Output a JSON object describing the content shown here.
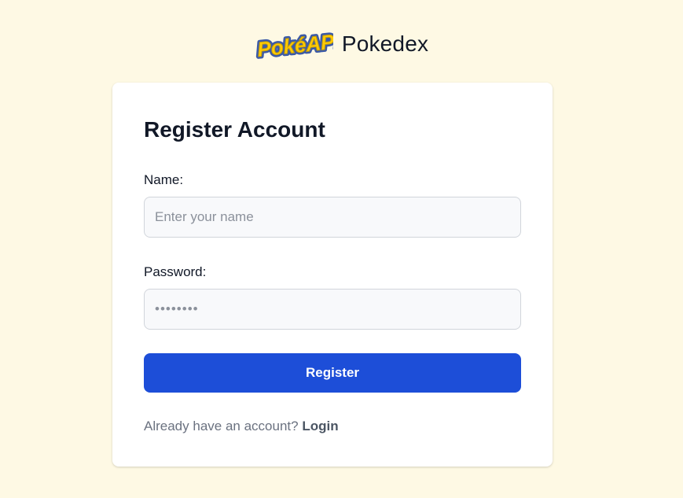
{
  "brand": {
    "logo_text": "PokéAPI",
    "title": "Pokedex"
  },
  "form": {
    "title": "Register Account",
    "name_label": "Name:",
    "name_placeholder": "Enter your name",
    "name_value": "",
    "password_label": "Password:",
    "password_placeholder": "••••••••",
    "password_value": "",
    "submit_label": "Register"
  },
  "footer": {
    "prompt_text": "Already have an account?",
    "login_label": "Login"
  },
  "colors": {
    "page_background": "#fef9e4",
    "card_background": "#ffffff",
    "button_background": "#1d4ed8",
    "logo_yellow": "#ffcb05",
    "logo_blue": "#3c5aa6"
  }
}
